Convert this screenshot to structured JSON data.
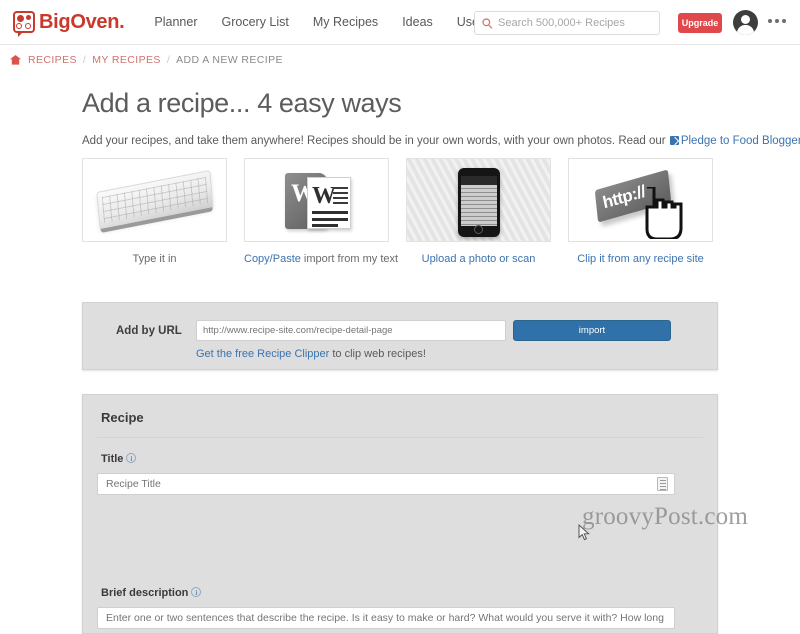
{
  "header": {
    "logo_text": "BigOven.",
    "logo_icon": "bigoven-burner-logo-icon",
    "nav": [
      {
        "label": "Planner"
      },
      {
        "label": "Grocery List"
      },
      {
        "label": "My Recipes"
      },
      {
        "label": "Ideas"
      },
      {
        "label": "Use Up Leftovers"
      }
    ],
    "search": {
      "placeholder": "Search 500,000+ Recipes",
      "value": "",
      "icon": "search-icon"
    },
    "upgrade_label": "Upgrade",
    "avatar_icon": "user-avatar-icon",
    "more_icon": "more-dots-icon"
  },
  "breadcrumb": {
    "home_icon": "home-icon",
    "items": [
      {
        "label": "RECIPES",
        "type": "link"
      },
      {
        "label": "MY RECIPES",
        "type": "link"
      },
      {
        "label": "ADD A NEW RECIPE",
        "type": "current"
      }
    ],
    "separator": "/"
  },
  "main": {
    "page_title": "Add a recipe... 4 easy ways",
    "intro_text": "Add your recipes, and take them anywhere! Recipes should be in your own words, with your own photos. Read our",
    "intro_link": "Pledge to Food Bloggers.",
    "intro_link_icon": "external-link-icon",
    "cards": [
      {
        "image": "keyboard-image",
        "caption_link": "",
        "caption_text": "Type it in"
      },
      {
        "image": "word-document-image",
        "caption_link": "Copy/Paste",
        "caption_text": " import from my text"
      },
      {
        "image": "phone-photo-image",
        "caption_link": "Upload a photo or scan",
        "caption_text": ""
      },
      {
        "image": "http-key-cursor-image",
        "caption_link": "Clip it from any recipe site",
        "caption_text": ""
      }
    ],
    "http_key_text": "http://"
  },
  "url_panel": {
    "label": "Add by URL",
    "input_placeholder": "http://www.recipe-site.com/recipe-detail-page",
    "input_value": "",
    "import_label": "import",
    "clipper_link": "Get the free Recipe Clipper",
    "clipper_text": " to clip web recipes!"
  },
  "recipe_panel": {
    "heading": "Recipe",
    "title_label": "Title",
    "title_placeholder": "Recipe Title",
    "title_value": "",
    "title_input_icon": "text-options-icon",
    "desc_label": "Brief description",
    "desc_placeholder": "Enter one or two sentences that describe the recipe. Is it easy to make or hard? What would you serve it with? How long does it take?",
    "desc_value": "",
    "info_icon": "info-icon",
    "info_glyph": "i"
  },
  "watermark": {
    "text": "groovyPost.com"
  },
  "colors": {
    "brand_red": "#c9392c",
    "upgrade_red": "#e0494b",
    "link_blue": "#3b73af",
    "button_blue": "#3071a9",
    "panel_gray": "#dedede",
    "text_gray": "#5a5a5a"
  }
}
